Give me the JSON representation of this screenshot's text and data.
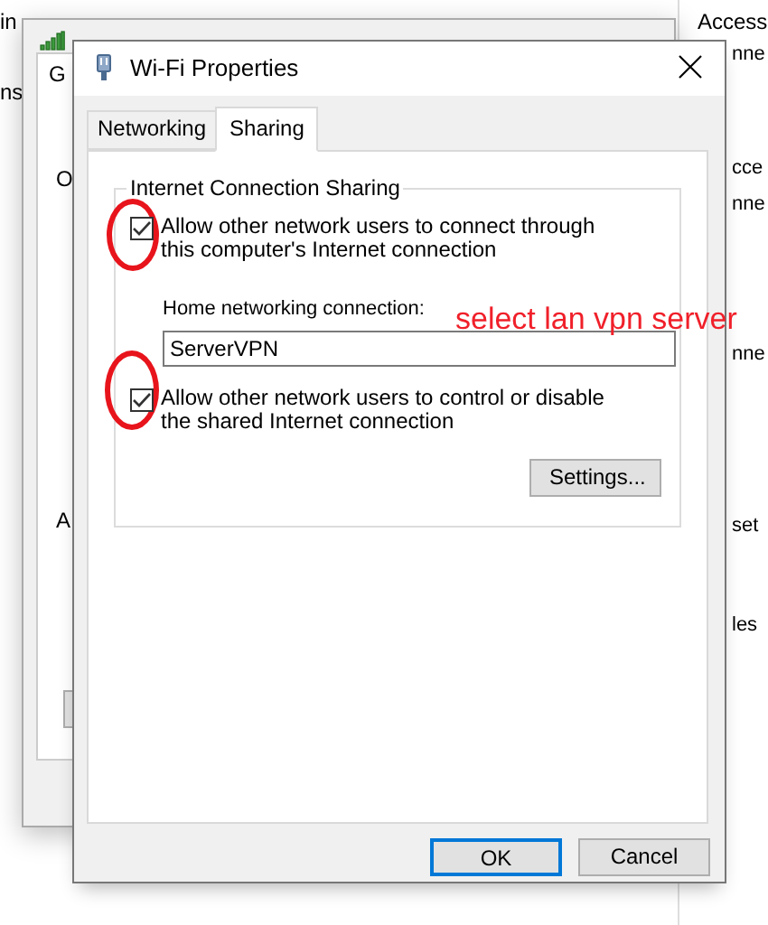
{
  "background_windows": {
    "far_left_fragments": [
      "in",
      "ns"
    ],
    "status_window": {
      "tab_fragment": "G",
      "text_fragments": [
        "O",
        "A"
      ]
    },
    "right_fragments": [
      "Access",
      "nne",
      "cce",
      "nne",
      "nne",
      "set",
      "les"
    ]
  },
  "dialog": {
    "title": "Wi-Fi Properties",
    "tabs": [
      {
        "label": "Networking",
        "selected": false
      },
      {
        "label": "Sharing",
        "selected": true
      }
    ],
    "group_title": "Internet Connection Sharing",
    "share_option": {
      "label": "Allow other network users to connect through this computer's Internet connection",
      "checked": true
    },
    "home_connection": {
      "label": "Home networking connection:",
      "value": "ServerVPN"
    },
    "control_option": {
      "label": "Allow other network users to control or disable the shared Internet connection",
      "checked": true
    },
    "settings_button": "Settings...",
    "buttons": [
      {
        "label": "OK",
        "default": true
      },
      {
        "label": "Cancel",
        "default": false
      }
    ]
  },
  "annotation": {
    "text": "select lan vpn server"
  }
}
